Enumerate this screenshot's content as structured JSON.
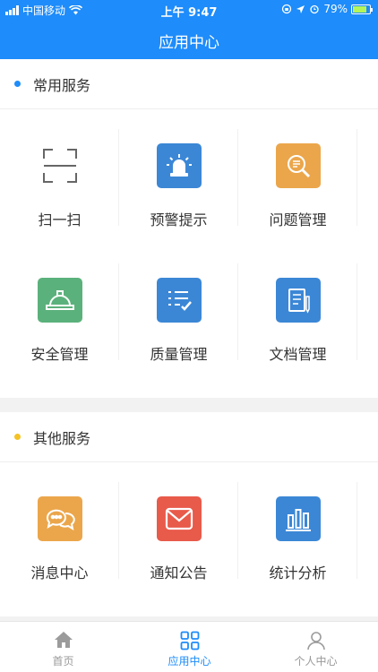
{
  "status": {
    "carrier": "中国移动",
    "time": "上午 9:47",
    "battery": "79%"
  },
  "header": {
    "title": "应用中心"
  },
  "sections": [
    {
      "title": "常用服务",
      "dot_color": "#1e8cfa",
      "items": [
        {
          "label": "扫一扫",
          "icon": "scan-icon",
          "color": ""
        },
        {
          "label": "预警提示",
          "icon": "alarm-siren-icon",
          "color": "#3b87d6"
        },
        {
          "label": "问题管理",
          "icon": "magnifier-document-icon",
          "color": "#eba64b"
        },
        {
          "label": "安全管理",
          "icon": "hard-hat-icon",
          "color": "#5bb17b"
        },
        {
          "label": "质量管理",
          "icon": "checklist-icon",
          "color": "#3b87d6"
        },
        {
          "label": "文档管理",
          "icon": "document-pen-icon",
          "color": "#3b87d6"
        }
      ]
    },
    {
      "title": "其他服务",
      "dot_color": "#f5c223",
      "items": [
        {
          "label": "消息中心",
          "icon": "chat-bubbles-icon",
          "color": "#eba64b"
        },
        {
          "label": "通知公告",
          "icon": "envelope-icon",
          "color": "#e85a4a"
        },
        {
          "label": "统计分析",
          "icon": "bar-chart-icon",
          "color": "#3b87d6"
        }
      ]
    }
  ],
  "tabs": [
    {
      "label": "首页",
      "icon": "home-icon",
      "active": false
    },
    {
      "label": "应用中心",
      "icon": "apps-grid-icon",
      "active": true
    },
    {
      "label": "个人中心",
      "icon": "user-icon",
      "active": false
    }
  ]
}
